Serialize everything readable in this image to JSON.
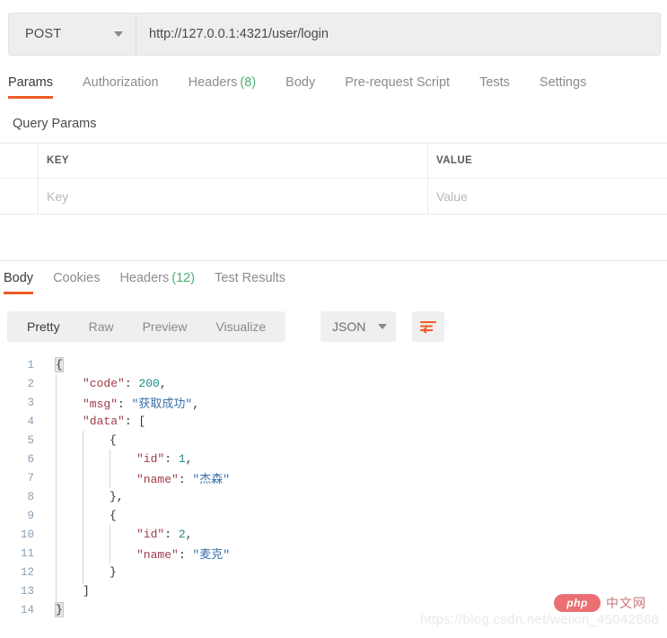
{
  "request": {
    "method": "POST",
    "url": "http://127.0.0.1:4321/user/login",
    "tabs": [
      {
        "label": "Params",
        "count": "",
        "active": true
      },
      {
        "label": "Authorization",
        "count": "",
        "active": false
      },
      {
        "label": "Headers",
        "count": "(8)",
        "active": false
      },
      {
        "label": "Body",
        "count": "",
        "active": false
      },
      {
        "label": "Pre-request Script",
        "count": "",
        "active": false
      },
      {
        "label": "Tests",
        "count": "",
        "active": false
      },
      {
        "label": "Settings",
        "count": "",
        "active": false
      }
    ],
    "query_params": {
      "section_title": "Query Params",
      "headers": {
        "key": "KEY",
        "value": "VALUE"
      },
      "rows": [
        {
          "key_placeholder": "Key",
          "value_placeholder": "Value"
        }
      ]
    }
  },
  "response": {
    "tabs": [
      {
        "label": "Body",
        "count": "",
        "active": true
      },
      {
        "label": "Cookies",
        "count": "",
        "active": false
      },
      {
        "label": "Headers",
        "count": "(12)",
        "active": false
      },
      {
        "label": "Test Results",
        "count": "",
        "active": false
      }
    ],
    "format_options": [
      {
        "label": "Pretty",
        "active": true
      },
      {
        "label": "Raw",
        "active": false
      },
      {
        "label": "Preview",
        "active": false
      },
      {
        "label": "Visualize",
        "active": false
      }
    ],
    "language": "JSON",
    "wrap_button_title": "Wrap line",
    "body_lines": [
      {
        "n": "1",
        "depth": 0,
        "tokens": [
          {
            "t": "pun",
            "v": "{",
            "hl": true
          }
        ]
      },
      {
        "n": "2",
        "depth": 1,
        "tokens": [
          {
            "t": "key",
            "v": "\"code\""
          },
          {
            "t": "pun",
            "v": ": "
          },
          {
            "t": "num",
            "v": "200"
          },
          {
            "t": "pun",
            "v": ","
          }
        ]
      },
      {
        "n": "3",
        "depth": 1,
        "tokens": [
          {
            "t": "key",
            "v": "\"msg\""
          },
          {
            "t": "pun",
            "v": ": "
          },
          {
            "t": "str",
            "v": "\"获取成功\""
          },
          {
            "t": "pun",
            "v": ","
          }
        ]
      },
      {
        "n": "4",
        "depth": 1,
        "tokens": [
          {
            "t": "key",
            "v": "\"data\""
          },
          {
            "t": "pun",
            "v": ": "
          },
          {
            "t": "pun",
            "v": "["
          }
        ]
      },
      {
        "n": "5",
        "depth": 2,
        "tokens": [
          {
            "t": "pun",
            "v": "{"
          }
        ]
      },
      {
        "n": "6",
        "depth": 3,
        "tokens": [
          {
            "t": "key",
            "v": "\"id\""
          },
          {
            "t": "pun",
            "v": ": "
          },
          {
            "t": "num",
            "v": "1"
          },
          {
            "t": "pun",
            "v": ","
          }
        ]
      },
      {
        "n": "7",
        "depth": 3,
        "tokens": [
          {
            "t": "key",
            "v": "\"name\""
          },
          {
            "t": "pun",
            "v": ": "
          },
          {
            "t": "str",
            "v": "\"杰森\""
          }
        ]
      },
      {
        "n": "8",
        "depth": 2,
        "tokens": [
          {
            "t": "pun",
            "v": "},"
          }
        ]
      },
      {
        "n": "9",
        "depth": 2,
        "tokens": [
          {
            "t": "pun",
            "v": "{"
          }
        ]
      },
      {
        "n": "10",
        "depth": 3,
        "tokens": [
          {
            "t": "key",
            "v": "\"id\""
          },
          {
            "t": "pun",
            "v": ": "
          },
          {
            "t": "num",
            "v": "2"
          },
          {
            "t": "pun",
            "v": ","
          }
        ]
      },
      {
        "n": "11",
        "depth": 3,
        "tokens": [
          {
            "t": "key",
            "v": "\"name\""
          },
          {
            "t": "pun",
            "v": ": "
          },
          {
            "t": "str",
            "v": "\"麦克\""
          }
        ]
      },
      {
        "n": "12",
        "depth": 2,
        "tokens": [
          {
            "t": "pun",
            "v": "}"
          }
        ]
      },
      {
        "n": "13",
        "depth": 1,
        "tokens": [
          {
            "t": "pun",
            "v": "]"
          }
        ]
      },
      {
        "n": "14",
        "depth": 0,
        "tokens": [
          {
            "t": "pun",
            "v": "}",
            "hl": true
          }
        ]
      }
    ]
  },
  "watermark": {
    "url": "https://blog.csdn.net/weixin_45042868",
    "logo_text": "php",
    "logo_cn": "中文网"
  },
  "colors": {
    "accent": "#ef5b25",
    "count_green": "#4caf72",
    "json_key": "#a13b4b",
    "json_string": "#3b6fa8",
    "json_number": "#1d8a84"
  }
}
